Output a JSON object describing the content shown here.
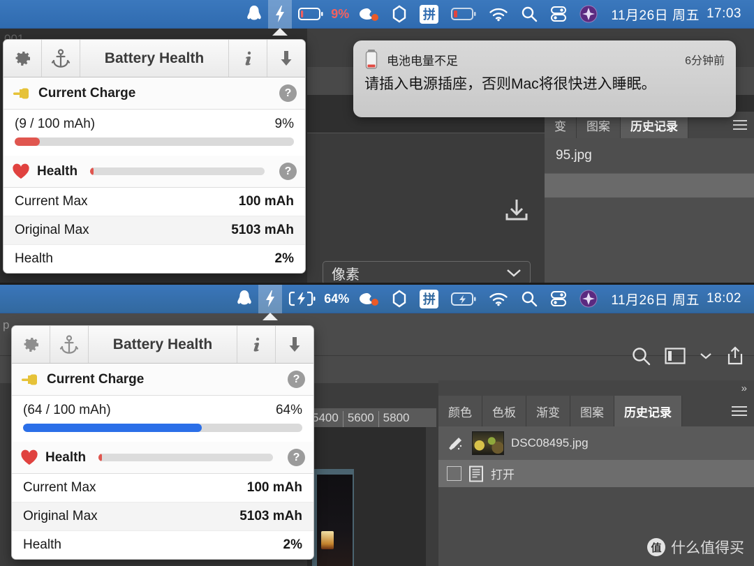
{
  "top": {
    "menubar": {
      "icons": [
        "qq-icon",
        "lightning-bolt-icon",
        "battery-icon",
        "weibo-icon",
        "hexagon-icon",
        "pinyin-input-icon",
        "battery-low-icon",
        "wifi-icon",
        "search-icon",
        "control-center-icon",
        "siri-icon"
      ],
      "battery_percent": "9%",
      "pinyin_label": "拼",
      "clock_date": "11月26日 周五",
      "clock_time": "17:03"
    },
    "panel": {
      "toolbar": {
        "gear": "gear-icon",
        "anchor": "anchor-icon",
        "title": "Battery Health",
        "info": "info-icon",
        "download": "download-arrow-icon"
      },
      "current_charge": {
        "section_label": "Current Charge",
        "help": "?",
        "value_label": "(9 / 100 mAh)",
        "percent_label": "9%",
        "percent": 9,
        "bar_color": "#e0564f"
      },
      "health": {
        "section_label": "Health",
        "help": "?",
        "percent": 2,
        "bar_color": "#e0564f",
        "rows": [
          {
            "label": "Current Max",
            "value": "100 mAh"
          },
          {
            "label": "Original Max",
            "value": "5103 mAh"
          },
          {
            "label": "Health",
            "value": "2%"
          }
        ]
      }
    },
    "notification": {
      "icon": "battery-low-icon",
      "title": "电池电量不足",
      "time": "6分钟前",
      "body": "请插入电源插座，否则Mac将很快进入睡眠。"
    },
    "background": {
      "tabs": [
        "变",
        "图案",
        "历史记录"
      ],
      "active_tab": "历史记录",
      "file_name": "95.jpg",
      "dropdown_label": "像素",
      "menu_icon": "hamburger-icon",
      "import_icon": "import-arrow-icon"
    }
  },
  "bottom": {
    "menubar": {
      "icons": [
        "qq-icon",
        "lightning-bolt-icon",
        "battery-charging-icon",
        "weibo-icon",
        "hexagon-icon",
        "pinyin-input-icon",
        "battery-charging-small-icon",
        "wifi-icon",
        "search-icon",
        "control-center-icon",
        "siri-icon"
      ],
      "battery_percent": "64%",
      "pinyin_label": "拼",
      "clock_date": "11月26日 周五",
      "clock_time": "18:02"
    },
    "panel": {
      "toolbar": {
        "gear": "gear-icon",
        "anchor": "anchor-icon",
        "title": "Battery Health",
        "info": "info-icon",
        "download": "download-arrow-icon"
      },
      "current_charge": {
        "section_label": "Current Charge",
        "help": "?",
        "value_label": "(64 / 100 mAh)",
        "percent_label": "64%",
        "percent": 64,
        "bar_color": "#2b6fe8"
      },
      "health": {
        "section_label": "Health",
        "help": "?",
        "percent": 2,
        "bar_color": "#e0564f",
        "rows": [
          {
            "label": "Current Max",
            "value": "100 mAh"
          },
          {
            "label": "Original Max",
            "value": "5103 mAh"
          },
          {
            "label": "Health",
            "value": "2%"
          }
        ]
      }
    },
    "background": {
      "ruler_ticks": [
        "5400",
        "5600",
        "5800"
      ],
      "toolbar_icons": [
        "search-icon",
        "panel-layout-icon",
        "chevron-down-icon",
        "share-icon"
      ],
      "overflow_icon": "»",
      "tabs": [
        "颜色",
        "色板",
        "渐变",
        "图案",
        "历史记录"
      ],
      "active_tab": "历史记录",
      "menu_icon": "hamburger-icon",
      "history": [
        {
          "label": "DSC08495.jpg",
          "icon": "snapshot-brush-icon"
        },
        {
          "label": "打开",
          "icon": "document-icon"
        }
      ]
    },
    "watermark": {
      "badge": "值",
      "text": "什么值得买"
    }
  }
}
